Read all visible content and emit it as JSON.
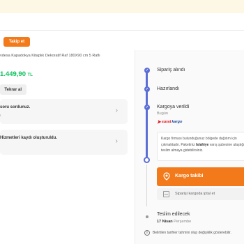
{
  "header": {
    "follow_label": "Takip et"
  },
  "product": {
    "title": "vdesa Kapadokya Kitaplık Dekoratif Raf 180X90 cm 5 Raflı",
    "price": "1.449,90",
    "currency": "TL",
    "reorder_label": "Tekrar al"
  },
  "cards": [
    {
      "text": "soru sordunuz.",
      "sub": "ı"
    },
    {
      "text": "Hizmetleri kaydı oluşturuldu.",
      "sub": ""
    }
  ],
  "timeline": {
    "steps": [
      {
        "label": "Sipariş alındı"
      },
      {
        "label": "Hazırlandı"
      },
      {
        "label": "Kargoya verildi",
        "sub": "Bugün"
      }
    ],
    "carrier": {
      "part1": "surat",
      "part2": "kargo"
    },
    "info": {
      "pre": "Kargo firması bulunduğunuz bölgede dağıtım için çıkmaktadır. Paketiniz ",
      "city": "Islahiye",
      "post": " varış şubesine ulaştığında teslim almaya gidebilirsiniz."
    },
    "track_label": "Kargo takibi",
    "cancel_label": "Siparişi kargoda iptal et",
    "delivery": {
      "label": "Teslim edilecek",
      "date": "17 Nisan",
      "weekday": "Perşembe"
    },
    "note": "Belirtilen tarihler tahmini olup değişiklik gösterebilir."
  },
  "colors": {
    "brand": "#f27a1a",
    "accent": "#5b6ed6",
    "price": "#0bc15c"
  }
}
